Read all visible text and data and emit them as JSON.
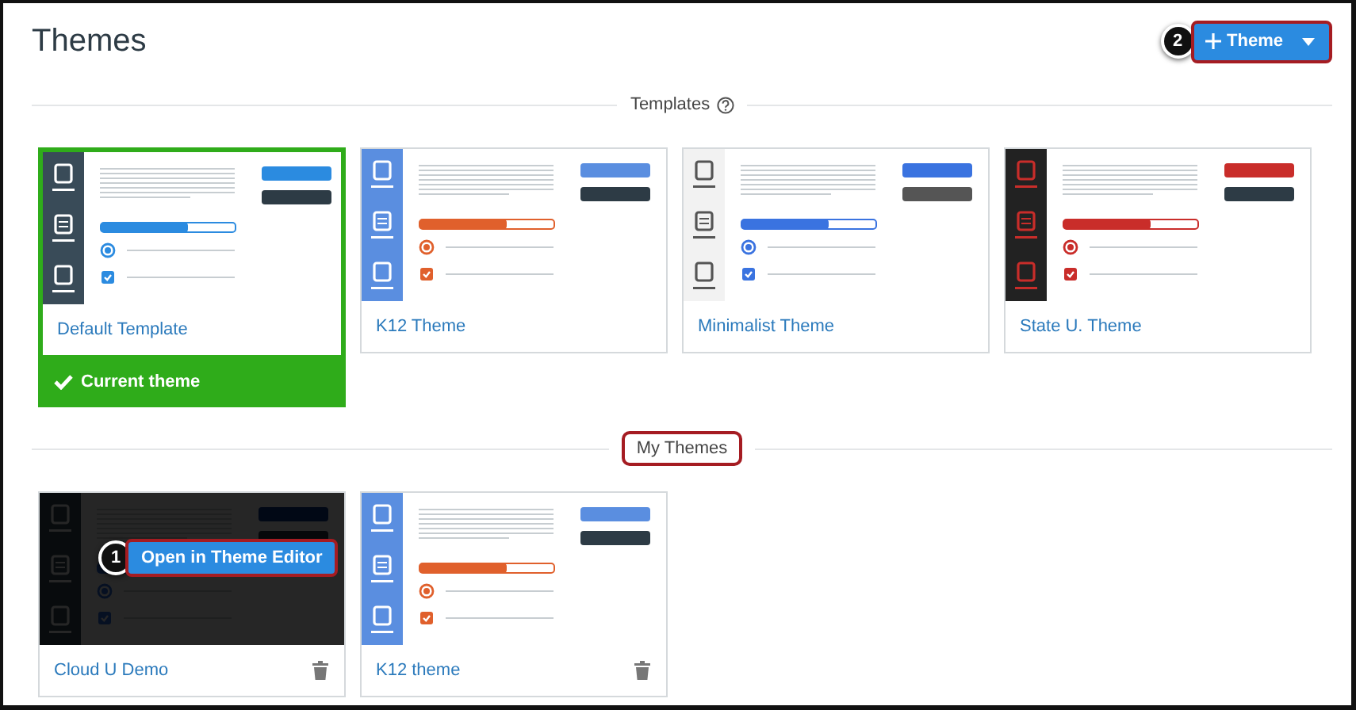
{
  "page": {
    "title": "Themes"
  },
  "add_button": {
    "label": "Theme",
    "callout": "2"
  },
  "sections": [
    {
      "title": "Templates",
      "help": true,
      "highlighted": false,
      "cards": [
        {
          "name": "Default Template",
          "kind": "default",
          "current": true,
          "current_label": "Current theme",
          "hovered": false,
          "deletable": false
        },
        {
          "name": "K12 Theme",
          "kind": "k12",
          "current": false,
          "hovered": false,
          "deletable": false
        },
        {
          "name": "Minimalist Theme",
          "kind": "minimalist",
          "current": false,
          "hovered": false,
          "deletable": false
        },
        {
          "name": "State U. Theme",
          "kind": "stateu",
          "current": false,
          "hovered": false,
          "deletable": false
        }
      ]
    },
    {
      "title": "My Themes",
      "help": false,
      "highlighted": true,
      "cards": [
        {
          "name": "Cloud U Demo",
          "kind": "cloud",
          "current": false,
          "hovered": true,
          "hover_button": {
            "label": "Open in Theme Editor",
            "callout": "1"
          },
          "deletable": true
        },
        {
          "name": "K12 theme",
          "kind": "k12",
          "current": false,
          "hovered": false,
          "deletable": true
        }
      ]
    }
  ]
}
